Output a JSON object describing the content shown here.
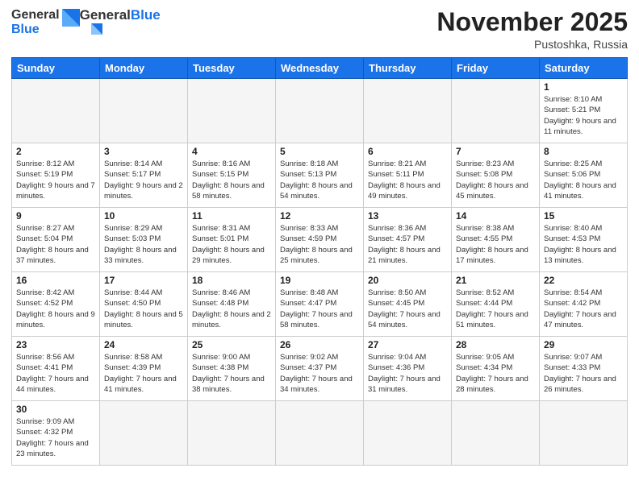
{
  "logo": {
    "text_general": "General",
    "text_blue": "Blue"
  },
  "header": {
    "month": "November 2025",
    "location": "Pustoshka, Russia"
  },
  "weekdays": [
    "Sunday",
    "Monday",
    "Tuesday",
    "Wednesday",
    "Thursday",
    "Friday",
    "Saturday"
  ],
  "weeks": [
    [
      {
        "day": "",
        "empty": true
      },
      {
        "day": "",
        "empty": true
      },
      {
        "day": "",
        "empty": true
      },
      {
        "day": "",
        "empty": true
      },
      {
        "day": "",
        "empty": true
      },
      {
        "day": "",
        "empty": true
      },
      {
        "day": "1",
        "info": "Sunrise: 8:10 AM\nSunset: 5:21 PM\nDaylight: 9 hours\nand 11 minutes."
      }
    ],
    [
      {
        "day": "2",
        "info": "Sunrise: 8:12 AM\nSunset: 5:19 PM\nDaylight: 9 hours\nand 7 minutes."
      },
      {
        "day": "3",
        "info": "Sunrise: 8:14 AM\nSunset: 5:17 PM\nDaylight: 9 hours\nand 2 minutes."
      },
      {
        "day": "4",
        "info": "Sunrise: 8:16 AM\nSunset: 5:15 PM\nDaylight: 8 hours\nand 58 minutes."
      },
      {
        "day": "5",
        "info": "Sunrise: 8:18 AM\nSunset: 5:13 PM\nDaylight: 8 hours\nand 54 minutes."
      },
      {
        "day": "6",
        "info": "Sunrise: 8:21 AM\nSunset: 5:11 PM\nDaylight: 8 hours\nand 49 minutes."
      },
      {
        "day": "7",
        "info": "Sunrise: 8:23 AM\nSunset: 5:08 PM\nDaylight: 8 hours\nand 45 minutes."
      },
      {
        "day": "8",
        "info": "Sunrise: 8:25 AM\nSunset: 5:06 PM\nDaylight: 8 hours\nand 41 minutes."
      }
    ],
    [
      {
        "day": "9",
        "info": "Sunrise: 8:27 AM\nSunset: 5:04 PM\nDaylight: 8 hours\nand 37 minutes."
      },
      {
        "day": "10",
        "info": "Sunrise: 8:29 AM\nSunset: 5:03 PM\nDaylight: 8 hours\nand 33 minutes."
      },
      {
        "day": "11",
        "info": "Sunrise: 8:31 AM\nSunset: 5:01 PM\nDaylight: 8 hours\nand 29 minutes."
      },
      {
        "day": "12",
        "info": "Sunrise: 8:33 AM\nSunset: 4:59 PM\nDaylight: 8 hours\nand 25 minutes."
      },
      {
        "day": "13",
        "info": "Sunrise: 8:36 AM\nSunset: 4:57 PM\nDaylight: 8 hours\nand 21 minutes."
      },
      {
        "day": "14",
        "info": "Sunrise: 8:38 AM\nSunset: 4:55 PM\nDaylight: 8 hours\nand 17 minutes."
      },
      {
        "day": "15",
        "info": "Sunrise: 8:40 AM\nSunset: 4:53 PM\nDaylight: 8 hours\nand 13 minutes."
      }
    ],
    [
      {
        "day": "16",
        "info": "Sunrise: 8:42 AM\nSunset: 4:52 PM\nDaylight: 8 hours\nand 9 minutes."
      },
      {
        "day": "17",
        "info": "Sunrise: 8:44 AM\nSunset: 4:50 PM\nDaylight: 8 hours\nand 5 minutes."
      },
      {
        "day": "18",
        "info": "Sunrise: 8:46 AM\nSunset: 4:48 PM\nDaylight: 8 hours\nand 2 minutes."
      },
      {
        "day": "19",
        "info": "Sunrise: 8:48 AM\nSunset: 4:47 PM\nDaylight: 7 hours\nand 58 minutes."
      },
      {
        "day": "20",
        "info": "Sunrise: 8:50 AM\nSunset: 4:45 PM\nDaylight: 7 hours\nand 54 minutes."
      },
      {
        "day": "21",
        "info": "Sunrise: 8:52 AM\nSunset: 4:44 PM\nDaylight: 7 hours\nand 51 minutes."
      },
      {
        "day": "22",
        "info": "Sunrise: 8:54 AM\nSunset: 4:42 PM\nDaylight: 7 hours\nand 47 minutes."
      }
    ],
    [
      {
        "day": "23",
        "info": "Sunrise: 8:56 AM\nSunset: 4:41 PM\nDaylight: 7 hours\nand 44 minutes."
      },
      {
        "day": "24",
        "info": "Sunrise: 8:58 AM\nSunset: 4:39 PM\nDaylight: 7 hours\nand 41 minutes."
      },
      {
        "day": "25",
        "info": "Sunrise: 9:00 AM\nSunset: 4:38 PM\nDaylight: 7 hours\nand 38 minutes."
      },
      {
        "day": "26",
        "info": "Sunrise: 9:02 AM\nSunset: 4:37 PM\nDaylight: 7 hours\nand 34 minutes."
      },
      {
        "day": "27",
        "info": "Sunrise: 9:04 AM\nSunset: 4:36 PM\nDaylight: 7 hours\nand 31 minutes."
      },
      {
        "day": "28",
        "info": "Sunrise: 9:05 AM\nSunset: 4:34 PM\nDaylight: 7 hours\nand 28 minutes."
      },
      {
        "day": "29",
        "info": "Sunrise: 9:07 AM\nSunset: 4:33 PM\nDaylight: 7 hours\nand 26 minutes."
      }
    ],
    [
      {
        "day": "30",
        "info": "Sunrise: 9:09 AM\nSunset: 4:32 PM\nDaylight: 7 hours\nand 23 minutes."
      },
      {
        "day": "",
        "empty": true
      },
      {
        "day": "",
        "empty": true
      },
      {
        "day": "",
        "empty": true
      },
      {
        "day": "",
        "empty": true
      },
      {
        "day": "",
        "empty": true
      },
      {
        "day": "",
        "empty": true
      }
    ]
  ]
}
